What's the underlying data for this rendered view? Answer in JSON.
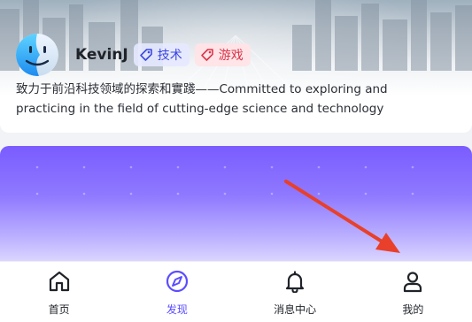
{
  "profile": {
    "username": "KevinJ",
    "avatar_icon": "finder-face-icon",
    "tags": [
      {
        "label": "技术",
        "icon": "tag-icon",
        "color": "#3b46e0"
      },
      {
        "label": "游戏",
        "icon": "tag-icon",
        "color": "#d8344a"
      }
    ],
    "bio_line1": "致力于前沿科技领域的探索和實踐——Committed to exploring and",
    "bio_line2": "practicing in the field of cutting-edge science and technology"
  },
  "tabbar": {
    "accent": "#5b4dff",
    "items": [
      {
        "label": "首页",
        "icon": "home-icon"
      },
      {
        "label": "发现",
        "icon": "compass-icon",
        "active": true
      },
      {
        "label": "消息中心",
        "icon": "bell-icon"
      },
      {
        "label": "我的",
        "icon": "user-icon"
      }
    ]
  },
  "colors": {
    "banner_top": "#7a5cff",
    "annotation_arrow": "#e8402a"
  }
}
